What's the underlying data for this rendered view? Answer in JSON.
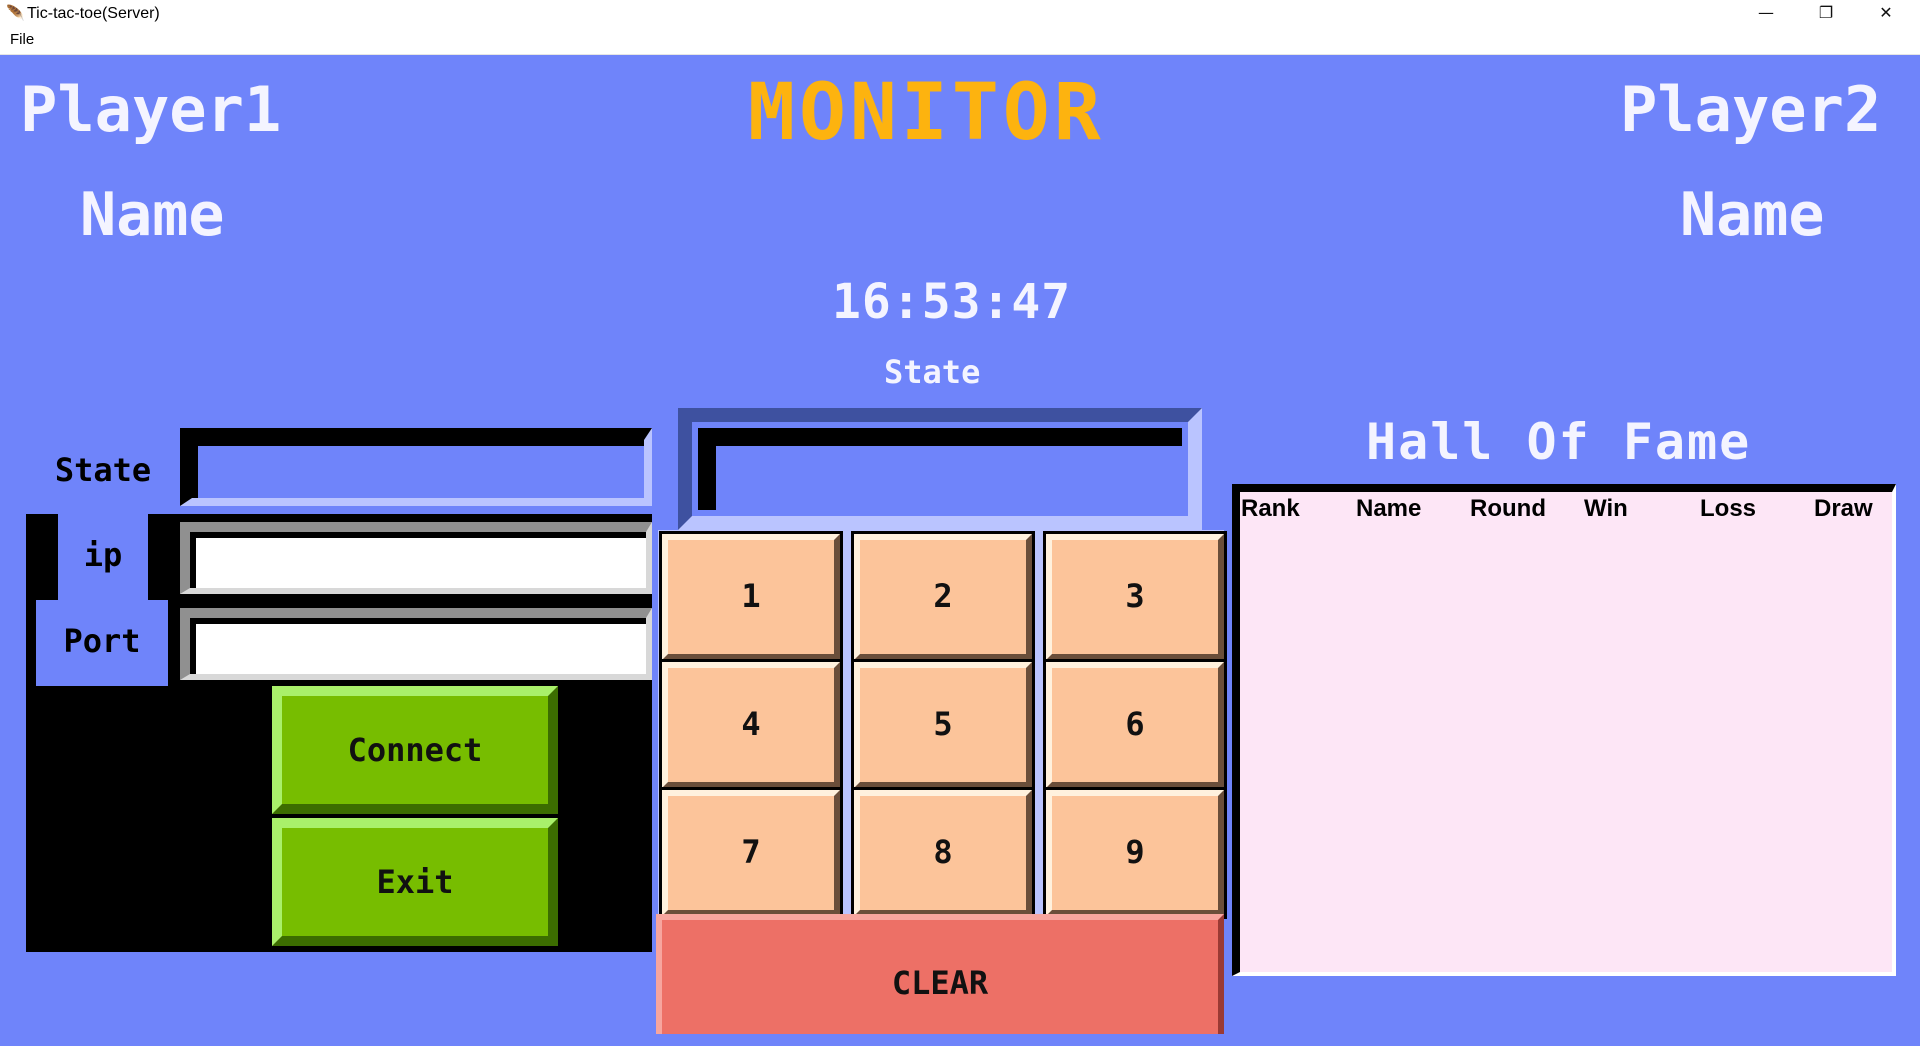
{
  "window": {
    "title": "Tic-tac-toe(Server)",
    "app_icon": "feather-icon",
    "controls": {
      "minimize": "—",
      "restore": "❐",
      "close": "✕"
    }
  },
  "menu": {
    "file_label": "File"
  },
  "header": {
    "title": "MONITOR",
    "player1_label": "Player1",
    "player2_label": "Player2",
    "player1_name": "Name",
    "player2_name": "Name",
    "clock": "16:53:47",
    "state_label": "State",
    "state_value": ""
  },
  "connection": {
    "state_label": "State",
    "state_value": "",
    "ip_label": "ip",
    "ip_value": "",
    "port_label": "Port",
    "port_value": "",
    "connect_label": "Connect",
    "exit_label": "Exit"
  },
  "keypad": {
    "keys": [
      "1",
      "2",
      "3",
      "4",
      "5",
      "6",
      "7",
      "8",
      "9"
    ],
    "clear_label": "CLEAR"
  },
  "hall_of_fame": {
    "title": "Hall Of Fame",
    "columns": [
      "Rank",
      "Name",
      "Round",
      "Win",
      "Loss",
      "Draw"
    ],
    "rows": []
  },
  "colors": {
    "background": "#6f84fa",
    "title_accent": "#fdb30f",
    "key_face": "#fcc49a",
    "button_green": "#77bd00",
    "clear_red": "#ed7066",
    "table_bg": "#fde6f6"
  }
}
